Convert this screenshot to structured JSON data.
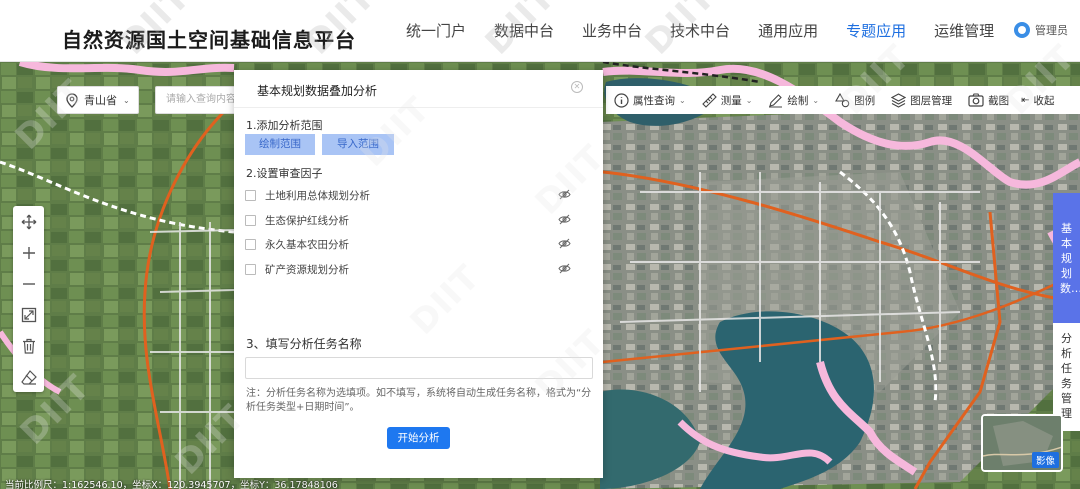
{
  "header": {
    "title": "自然资源国土空间基础信息平台",
    "nav": [
      "统一门户",
      "数据中台",
      "业务中台",
      "技术中台",
      "通用应用",
      "专题应用",
      "运维管理"
    ],
    "active_nav": "专题应用",
    "user": "管理员"
  },
  "map": {
    "region": "青山省",
    "search_placeholder": "请输入查询内容",
    "toolbar": [
      "属性查询",
      "测量",
      "绘制",
      "图例",
      "图层管理",
      "截图",
      "收起"
    ],
    "scale_text": "当前比例尺：1:162546.10，坐标X：120.3945707，坐标Y：36.17848106",
    "minimap_label": "影像",
    "side_tabs": [
      "基本规划数…",
      "分析任务管理"
    ]
  },
  "panel": {
    "title": "基本规划数据叠加分析",
    "step1": "1.添加分析范围",
    "draw_btn": "绘制范围",
    "import_btn": "导入范围",
    "step2": "2.设置审查因子",
    "factors": [
      "土地利用总体规划分析",
      "生态保护红线分析",
      "永久基本农田分析",
      "矿产资源规划分析"
    ],
    "step3": "3、填写分析任务名称",
    "note": "注：分析任务名称为选填项。如不填写，系统将自动生成任务名称，格式为“分析任务类型+日期时间”。",
    "start_btn": "开始分析"
  },
  "watermark": "DIIT",
  "colors": {
    "accent": "#1e6fe0",
    "button": "#1e78f0",
    "boundary": "#f6b8dc",
    "road": "#e0611f"
  }
}
